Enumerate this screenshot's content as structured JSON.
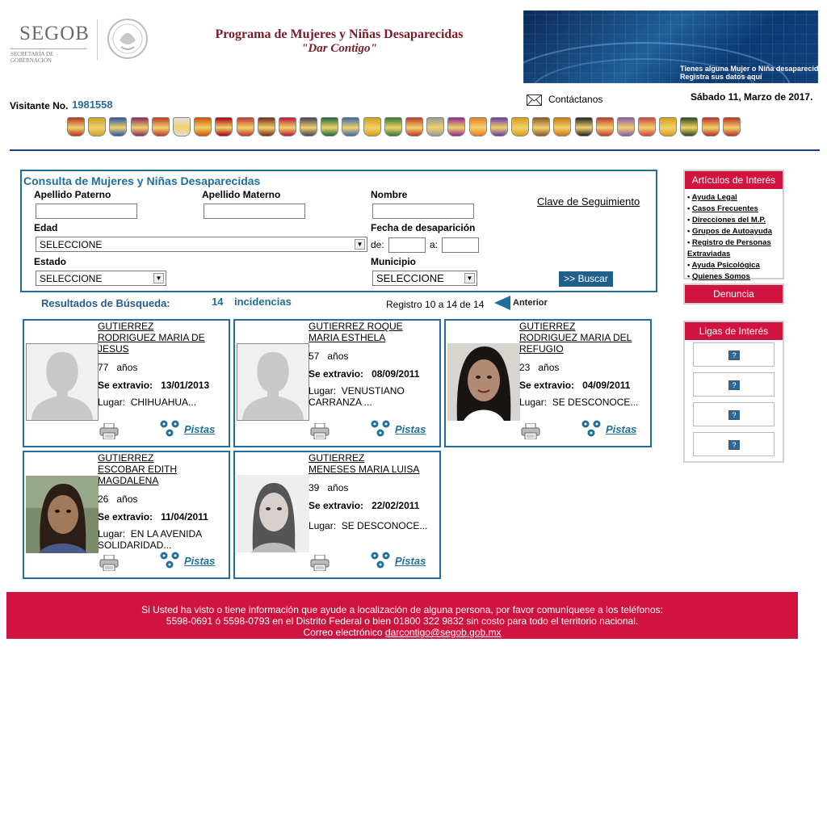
{
  "header": {
    "logo_text": "SEGOB",
    "logo_subtext": "SECRETARÍA DE GOBERNACIÓN",
    "program_title": "Programa de Mujeres y Niñas Desaparecidas",
    "program_subtitle": "\"Dar Contigo\"",
    "banner_line1": "Tienes alguna Mujer o Niña desaparecida",
    "banner_line2": "Registra sus datos aquí",
    "visitor_label": "Visitante No.",
    "visitor_number": "1981558",
    "contact_label": "Contáctanos",
    "date": "Sábado 11, Marzo de 2017."
  },
  "form": {
    "title": "Consulta de Mujeres y Niñas Desaparecidas",
    "apellido_paterno_label": "Apellido Paterno",
    "apellido_materno_label": "Apellido Materno",
    "nombre_label": "Nombre",
    "edad_label": "Edad",
    "edad_value": "SELECCIONE",
    "fecha_label": "Fecha de desaparición",
    "de_label": "de:",
    "a_label": "a:",
    "estado_label": "Estado",
    "estado_value": "SELECCIONE",
    "municipio_label": "Municipio",
    "municipio_value": "SELECCIONE",
    "clave_link": "Clave de Seguimiento",
    "buscar_button": ">> Buscar"
  },
  "results": {
    "label": "Resultados de Búsqueda:",
    "count": "14",
    "incidencias": "incidencias",
    "registro": "Registro 10 a 14 de 14",
    "anterior": "Anterior",
    "cards": [
      {
        "name": "GUTIERREZ RODRIGUEZ MARIA DE JESUS",
        "name_l1": "GUTIERREZ",
        "name_l2": " RODRIGUEZ MARIA DE",
        "name_l3": "JESUS",
        "age": "77",
        "age_unit": "años",
        "extravio_label": "Se extravio:",
        "date": "13/01/2013",
        "lugar_label": "Lugar:",
        "lugar_l1": "CHIHUAHUA...",
        "lugar_l2": "",
        "pistas": "Pistas",
        "photo": "silhouette"
      },
      {
        "name": "GUTIERREZ ROQUE MARIA ESTHELA",
        "name_l1": "GUTIERREZ  ROQUE",
        "name_l2": " MARIA ESTHELA",
        "name_l3": "",
        "age": "57",
        "age_unit": "años",
        "extravio_label": "Se extravio:",
        "date": "08/09/2011",
        "lugar_label": "Lugar:",
        "lugar_l1": "VENUSTIANO",
        "lugar_l2": "CARRANZA ...",
        "pistas": "Pistas",
        "photo": "silhouette"
      },
      {
        "name": "GUTIERREZ RODRIGUEZ MARIA DEL REFUGIO",
        "name_l1": "GUTIERREZ",
        "name_l2": " RODRIGUEZ MARIA DEL",
        "name_l3": "REFUGIO",
        "age": "23",
        "age_unit": "años",
        "extravio_label": "Se extravio:",
        "date": "04/09/2011",
        "lugar_label": "Lugar:",
        "lugar_l1": "SE DESCONOCE...",
        "lugar_l2": "",
        "pistas": "Pistas",
        "photo": "portrait-dark"
      },
      {
        "name": "GUTIERREZ ESCOBAR EDITH MAGDALENA",
        "name_l1": "GUTIERREZ",
        "name_l2": " ESCOBAR EDITH",
        "name_l3": "MAGDALENA",
        "age": "26",
        "age_unit": "años",
        "extravio_label": "Se extravio:",
        "date": "11/04/2011",
        "lugar_label": "Lugar:",
        "lugar_l1": "EN LA AVENIDA",
        "lugar_l2": "SOLIDARIDAD...",
        "pistas": "Pistas",
        "photo": "portrait-color"
      },
      {
        "name": "GUTIERREZ MENESES MARIA LUISA",
        "name_l1": "GUTIERREZ",
        "name_l2": " MENESES MARIA LUISA",
        "name_l3": "",
        "age": "39",
        "age_unit": "años",
        "extravio_label": "Se extravio:",
        "date": "22/02/2011",
        "lugar_label": "Lugar:",
        "lugar_l1": "SE DESCONOCE...",
        "lugar_l2": "",
        "pistas": "Pistas",
        "photo": "portrait-gray"
      }
    ]
  },
  "sidebar": {
    "articulos_title": "Artículos de Interés",
    "articulos": [
      "Ayuda Legal",
      "Casos Frecuentes",
      "Direcciones del M.P.",
      "Grupos de Autoayuda",
      "Registro de Personas Extraviadas",
      "Ayuda Psicológica",
      "Quienes Somos"
    ],
    "denuncia": "Denuncia",
    "ligas_title": "Ligas de Interés"
  },
  "footer": {
    "line1": "Si Usted ha visto o tiene información que ayude a localización de alguna persona, por favor comuníquese a los teléfonos:",
    "line2": "5598-0691 ó 5598-0793 en el Distrito Federal o bien 01800 322 9832 sin costo para todo el territorio nacional.",
    "email_label": "Correo electrónico",
    "email": "darcontigo@segob.gob.mx"
  },
  "colors": {
    "brand_blue": "#1f6f9a",
    "brand_red": "#d0143f",
    "title_maroon": "#7a1a2a"
  },
  "icons": [
    "printer-icon",
    "pistas-icon",
    "envelope-icon",
    "anterior-arrow-icon",
    "state-shield-icon",
    "help-icon"
  ]
}
